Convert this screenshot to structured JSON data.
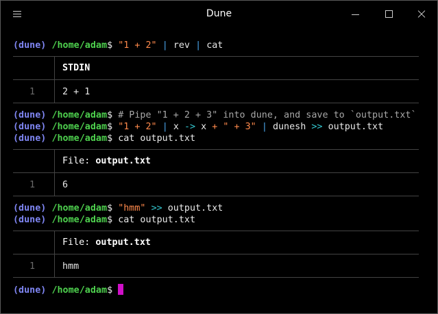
{
  "window": {
    "title": "Dune"
  },
  "prompt": {
    "dune": "(dune)",
    "path": "/home/adam",
    "dollar": "$"
  },
  "cmd1": {
    "str": "\"1 + 2\"",
    "pipe1": "|",
    "rev": "rev",
    "pipe2": "|",
    "cat": "cat"
  },
  "table1": {
    "header": "STDIN",
    "row_index": "1",
    "row_value": "2 + 1"
  },
  "cmd2": {
    "comment": "# Pipe \"1 + 2 + 3\" into dune, and save to `output.txt`"
  },
  "cmd3": {
    "str1": "\"1 + 2\"",
    "pipe1": "|",
    "x1": "x",
    "arrow": "->",
    "x2": "x",
    "plus": "+",
    "str2": "\" + 3\"",
    "pipe2": "|",
    "dunesh": "dunesh",
    "redirect": ">>",
    "file": "output.txt"
  },
  "cmd4": {
    "text": "cat output.txt"
  },
  "table2": {
    "label": "File:",
    "name": "output.txt",
    "row_index": "1",
    "row_value": "6"
  },
  "cmd5": {
    "str": "\"hmm\"",
    "redirect": ">>",
    "file": "output.txt"
  },
  "cmd6": {
    "text": "cat output.txt"
  },
  "table3": {
    "label": "File:",
    "name": "output.txt",
    "row_index": "1",
    "row_value": "hmm"
  },
  "colors": {
    "dune": "#7f86f3",
    "path": "#4ed04e",
    "string": "#ff8a4c",
    "pipe": "#4aa4ea",
    "operator": "#33c6cf",
    "cursor": "#d010c8"
  },
  "icons": [
    "hamburger-menu-icon",
    "minimize-icon",
    "maximize-icon",
    "close-icon"
  ]
}
